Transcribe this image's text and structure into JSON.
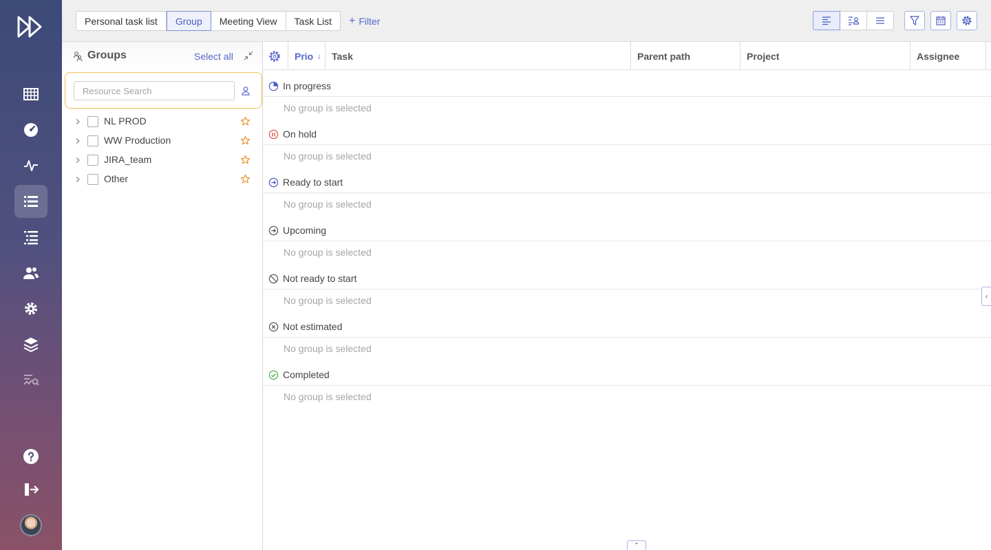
{
  "topbar": {
    "tabs": [
      {
        "label": "Personal task list"
      },
      {
        "label": "Group"
      },
      {
        "label": "Meeting View"
      },
      {
        "label": "Task List"
      }
    ],
    "filter_label": "Filter",
    "active_tab": "Group"
  },
  "groups": {
    "title": "Groups",
    "select_all": "Select all",
    "search_placeholder": "Resource Search",
    "items": [
      {
        "label": "NL PROD"
      },
      {
        "label": "WW Production"
      },
      {
        "label": "JIRA_team"
      },
      {
        "label": "Other"
      }
    ]
  },
  "table": {
    "columns": {
      "prio": "Prio",
      "task": "Task",
      "parent_path": "Parent path",
      "project": "Project",
      "assignee": "Assignee"
    },
    "sections": [
      {
        "label": "In progress",
        "icon": "progress-pie-icon",
        "empty": "No group is selected"
      },
      {
        "label": "On hold",
        "icon": "pause-circle-icon",
        "empty": "No group is selected"
      },
      {
        "label": "Ready to start",
        "icon": "arrow-circle-icon",
        "empty": "No group is selected"
      },
      {
        "label": "Upcoming",
        "icon": "arrow-circle-outline-icon",
        "empty": "No group is selected"
      },
      {
        "label": "Not ready to start",
        "icon": "prohibited-icon",
        "empty": "No group is selected"
      },
      {
        "label": "Not estimated",
        "icon": "x-circle-icon",
        "empty": "No group is selected"
      },
      {
        "label": "Completed",
        "icon": "check-circle-icon",
        "empty": "No group is selected"
      }
    ]
  },
  "colors": {
    "accent": "#5566cc",
    "on_hold": "#d9534f",
    "completed": "#4caf50",
    "search_highlight": "#f1c15a",
    "star": "#e8962e"
  }
}
